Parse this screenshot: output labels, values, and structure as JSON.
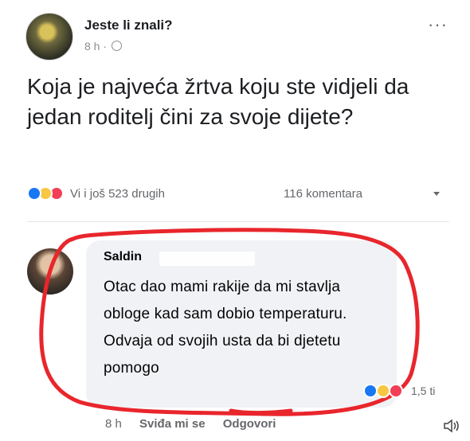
{
  "post": {
    "page_name": "Jeste li znali?",
    "meta": "8 h ·",
    "text": "Koja je najveća žrtva koju ste vidjeli da jedan roditelj čini za svoje dijete?",
    "reactions_text": "Vi i još 523 drugih",
    "comments_count": "116 komentara",
    "icons": [
      "globe-icon",
      "more-icon",
      "like-reaction-icon",
      "haha-reaction-icon",
      "love-reaction-icon"
    ]
  },
  "comment": {
    "name": "Saldin",
    "text": "Otac dao mami rakije da mi stavlja obloge kad sam dobio temperaturu. Odvaja od svojih usta da bi djetetu pomogo",
    "reactions_text": "1,5 ti",
    "time": "8 h",
    "like_label": "Sviđa mi se",
    "reply_label": "Odgovori"
  },
  "colors": {
    "highlight": "#e8262c",
    "bubble": "#f0f2f5",
    "like": "#1877f2",
    "haha": "#f7c744",
    "love": "#f33e58"
  }
}
